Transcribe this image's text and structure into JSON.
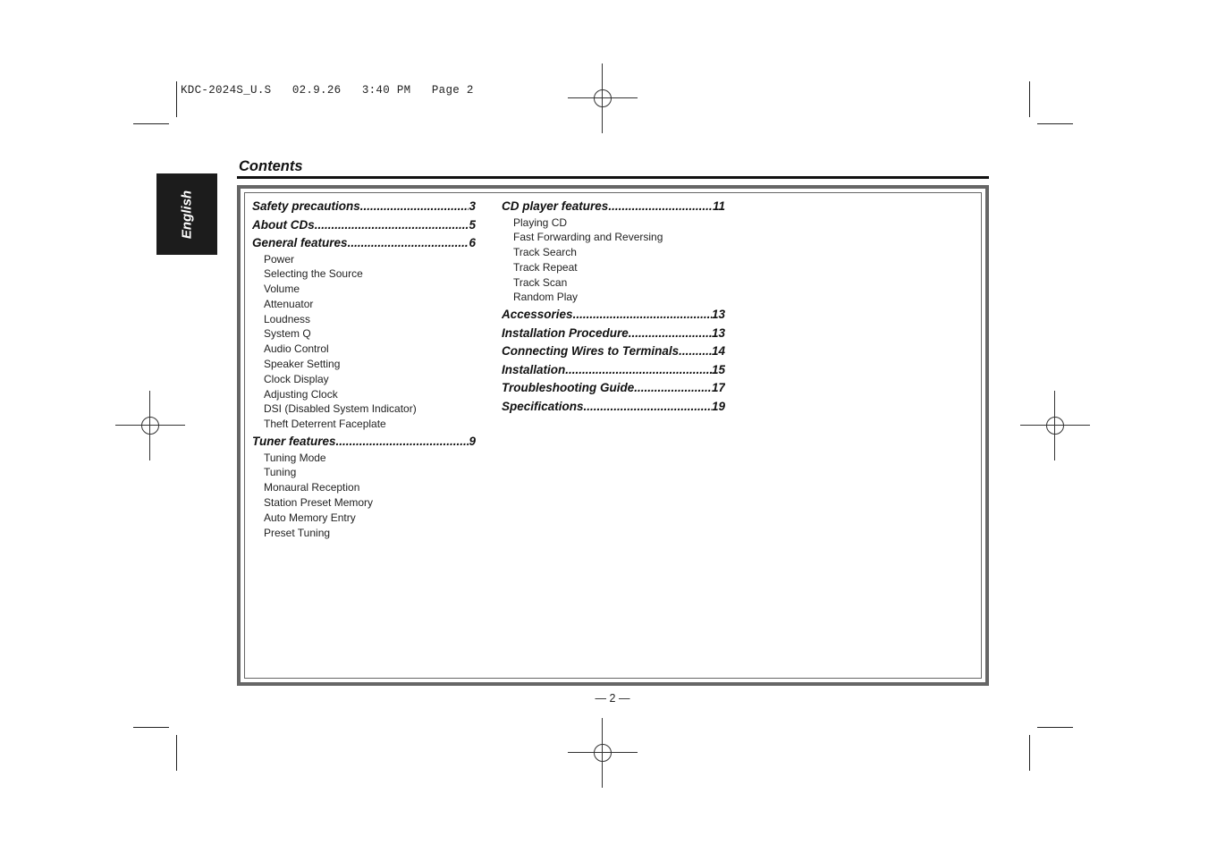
{
  "print_slug": "KDC-2024S_U.S   02.9.26   3:40 PM   Page 2",
  "language_tab": "English",
  "title": "Contents",
  "columns": [
    {
      "sections": [
        {
          "label": "Safety precautions",
          "page": "3",
          "items": []
        },
        {
          "label": "About CDs",
          "page": "5",
          "items": []
        },
        {
          "label": "General features ",
          "page": "6",
          "items": [
            "Power",
            "Selecting the Source",
            "Volume",
            "Attenuator",
            "Loudness",
            "System Q",
            "Audio Control",
            "Speaker Setting",
            "Clock Display",
            "Adjusting Clock",
            "DSI (Disabled System Indicator)",
            "Theft Deterrent Faceplate"
          ]
        },
        {
          "label": "Tuner features ",
          "page": "9",
          "items": [
            "Tuning Mode",
            "Tuning",
            "Monaural Reception",
            "Station Preset Memory",
            "Auto Memory Entry",
            "Preset Tuning"
          ]
        }
      ]
    },
    {
      "sections": [
        {
          "label": "CD player features",
          "page": "11",
          "items": [
            "Playing CD",
            "Fast Forwarding and Reversing",
            "Track Search",
            "Track Repeat",
            "Track Scan",
            "Random Play"
          ]
        },
        {
          "label": "Accessories",
          "page": "13",
          "items": []
        },
        {
          "label": "Installation Procedure ",
          "page": "13",
          "items": []
        },
        {
          "label": "Connecting Wires to Terminals ",
          "page": "14",
          "items": []
        },
        {
          "label": "Installation ",
          "page": "15",
          "items": []
        },
        {
          "label": "Troubleshooting Guide ",
          "page": "17",
          "items": []
        },
        {
          "label": "Specifications ",
          "page": "19",
          "items": []
        }
      ]
    }
  ],
  "page_number": "— 2 —"
}
